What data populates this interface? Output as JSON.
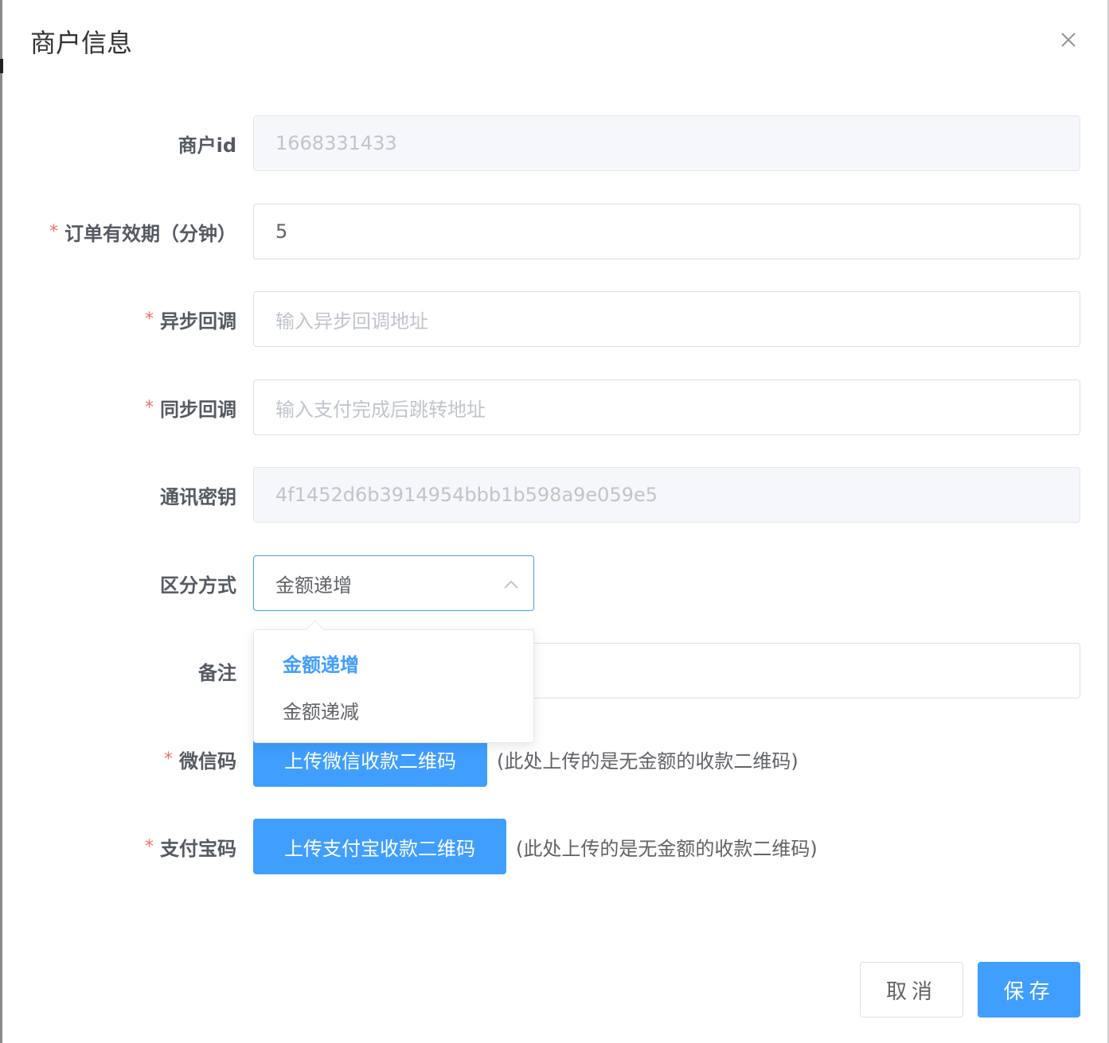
{
  "dialog": {
    "title": "商户信息",
    "close_icon": "close-icon"
  },
  "form": {
    "merchant_id": {
      "label": "商户id",
      "value": "1668331433"
    },
    "order_expiry": {
      "required_mark": "*",
      "label": "订单有效期（分钟）",
      "value": "5"
    },
    "async_callback": {
      "required_mark": "*",
      "label": "异步回调",
      "placeholder": "输入异步回调地址"
    },
    "sync_callback": {
      "required_mark": "*",
      "label": "同步回调",
      "placeholder": "输入支付完成后跳转地址"
    },
    "secret_key": {
      "label": "通讯密钥",
      "value": "4f1452d6b3914954bbb1b598a9e059e5"
    },
    "distinguish_mode": {
      "label": "区分方式",
      "selected": "金额递增",
      "options": [
        "金额递增",
        "金额递减"
      ],
      "arrow_icon": "chevron-up-icon"
    },
    "remark": {
      "label": "备注",
      "value": ""
    },
    "wechat_code": {
      "required_mark": "*",
      "label": "微信码",
      "button": "上传微信收款二维码",
      "hint": "(此处上传的是无金额的收款二维码)"
    },
    "alipay_code": {
      "required_mark": "*",
      "label": "支付宝码",
      "button": "上传支付宝收款二维码",
      "hint": "(此处上传的是无金额的收款二维码)"
    }
  },
  "footer": {
    "cancel_label": "取消",
    "save_label": "保存"
  },
  "colors": {
    "primary": "#409eff",
    "required": "#f56c6c",
    "disabled_bg": "#f5f7fa"
  }
}
